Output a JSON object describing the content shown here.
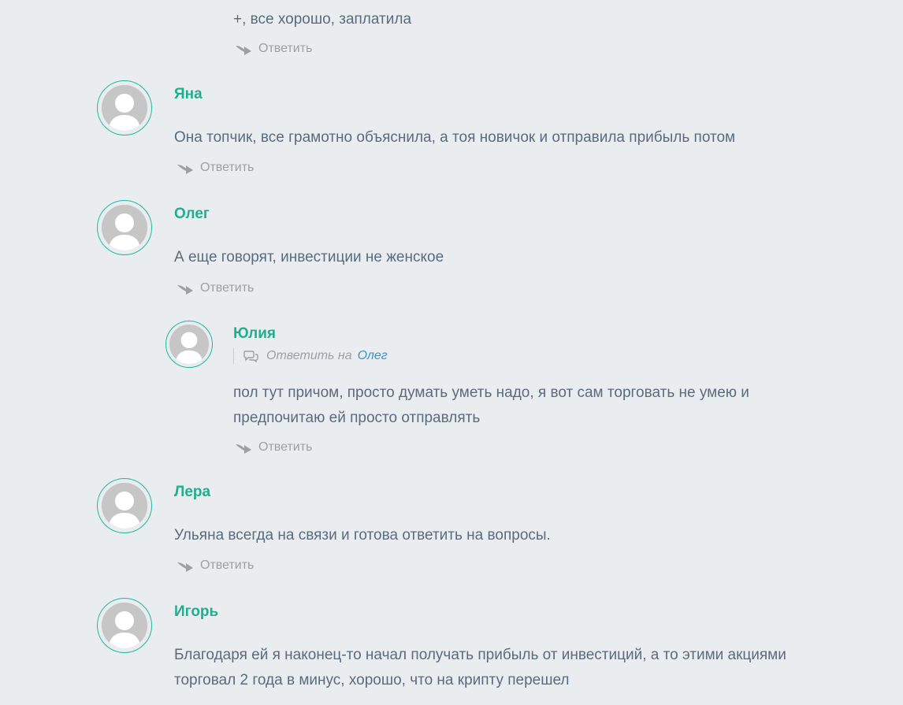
{
  "comments": [
    {
      "author": "",
      "lines": [
        "+, все хорошо, заплатила"
      ],
      "reply_label": "Ответить"
    },
    {
      "author": "Яна",
      "lines": [
        "Она топчик, все грамотно объяснила, а тоя новичок и отправила прибыль потом"
      ],
      "reply_label": "Ответить"
    },
    {
      "author": "Олег",
      "lines": [
        "А еще говорят, инвестиции не женское"
      ],
      "reply_label": "Ответить"
    },
    {
      "author": "Юлия",
      "reply_to_label": "Ответить на",
      "reply_to_target": "Олег",
      "lines": [
        "пол тут причом, просто думать уметь надо, я вот сам торговать не умею и",
        "предпочитаю ей просто отправлять"
      ],
      "reply_label": "Ответить"
    },
    {
      "author": "Лера",
      "lines": [
        "Ульяна всегда на связи и готова ответить на вопросы."
      ],
      "reply_label": "Ответить"
    },
    {
      "author": "Игорь",
      "lines": [
        "Благодаря ей я наконец-то начал получать прибыль от инвестиций, а то этими акциями",
        "торговал 2 года в минус, хорошо, что на крипту перешел"
      ]
    }
  ],
  "colors": {
    "background": "#eaedf0",
    "author": "#1fae8f",
    "avatar_ring": "#1fb89a",
    "text": "#5a6b7d",
    "muted": "#9aa0a6",
    "link": "#3d90c4"
  },
  "icons": {
    "avatar": "default-user-avatar",
    "reply": "reply-arrow-icon",
    "reply_to": "speech-bubbles-icon"
  }
}
